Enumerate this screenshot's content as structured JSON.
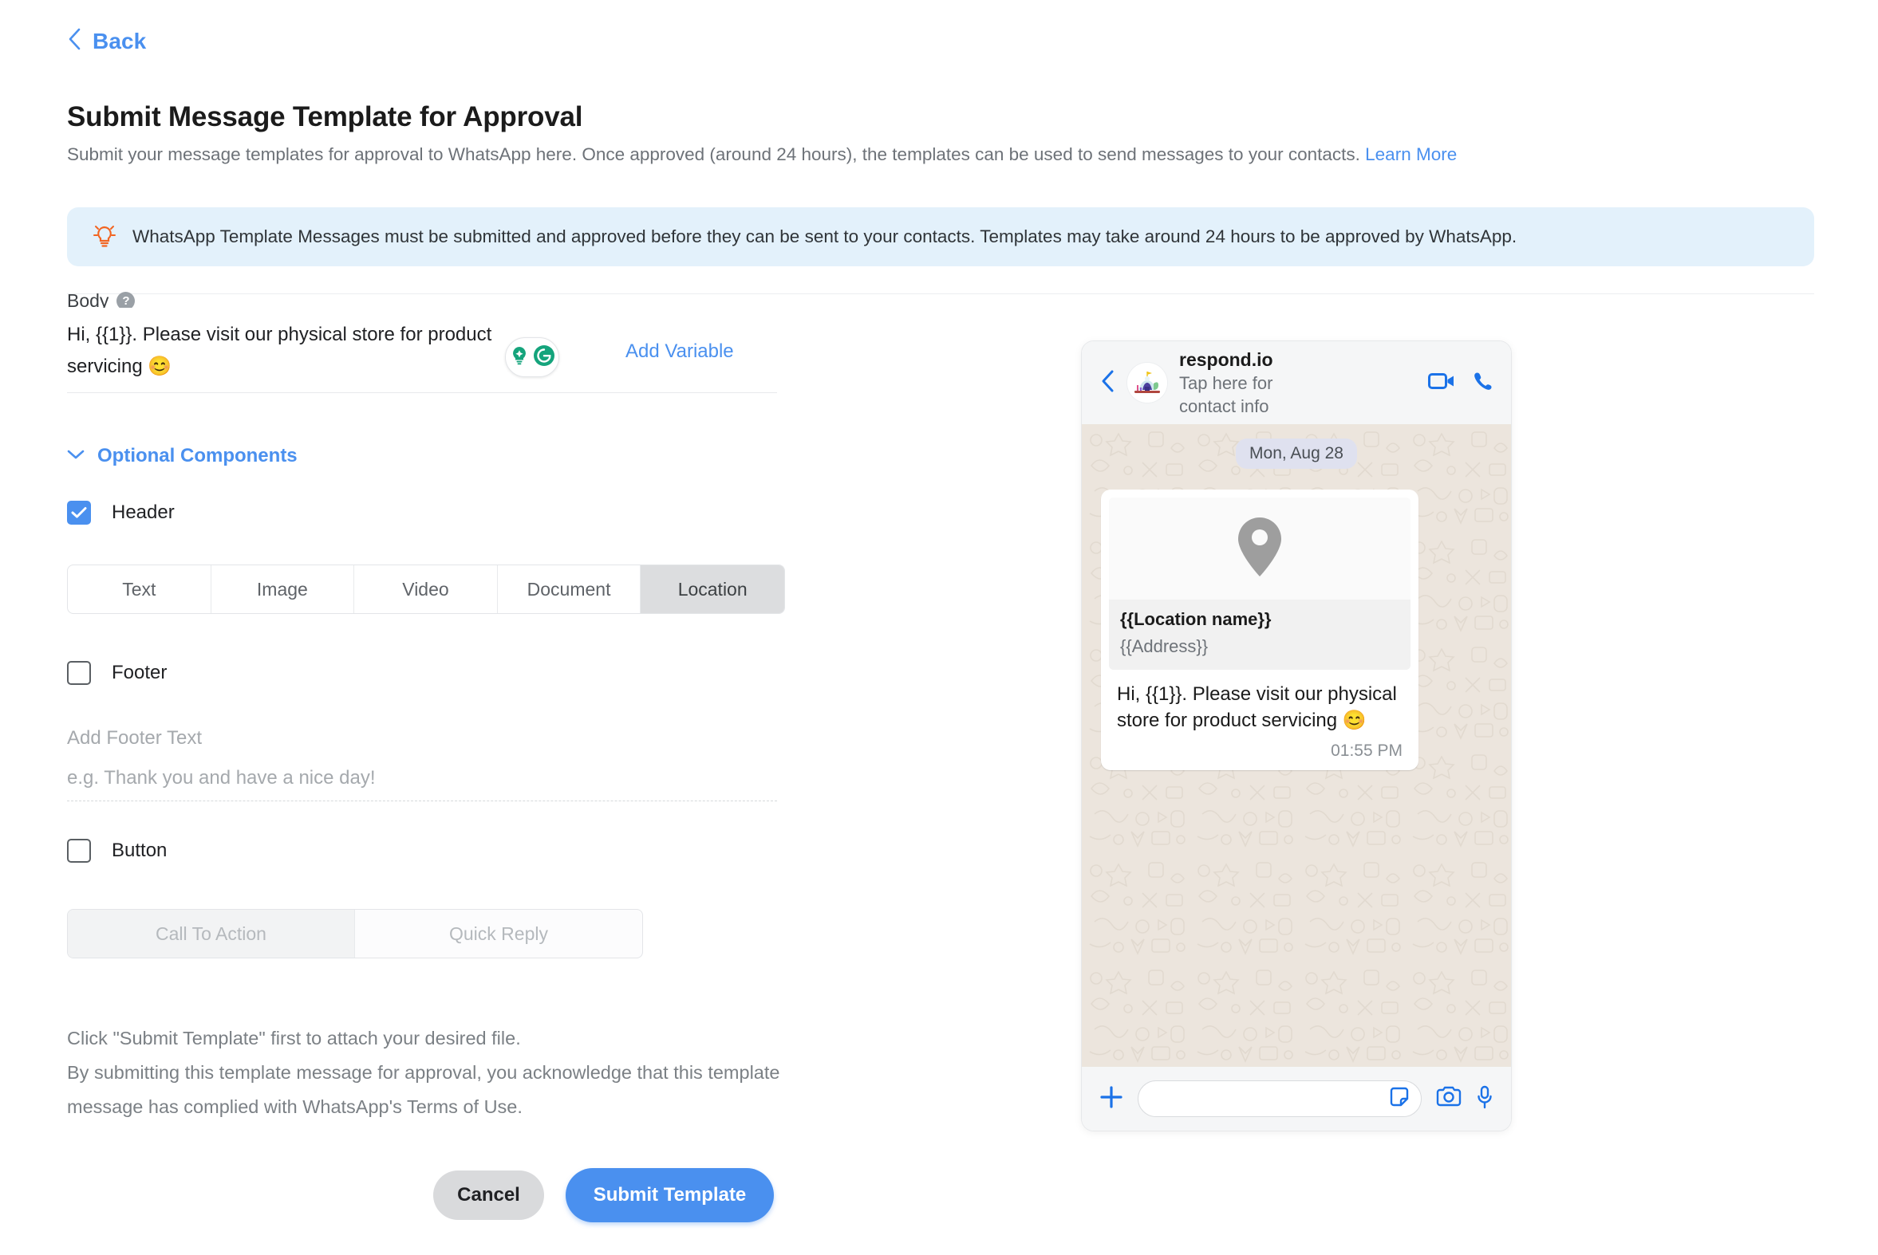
{
  "header": {
    "back_label": "Back",
    "title": "Submit Message Template for Approval",
    "description": "Submit your message templates for approval to WhatsApp here. Once approved (around 24 hours), the templates can be used to send messages to your contacts. ",
    "learn_more": "Learn More"
  },
  "banner": {
    "text": "WhatsApp Template Messages must be submitted and approved before they can be sent to your contacts. Templates may take around 24 hours to be approved by WhatsApp."
  },
  "body_section": {
    "label": "Body",
    "help_glyph": "?",
    "text": "Hi, {{1}}. Please visit our physical store for product servicing 😊",
    "add_variable_label": "Add Variable"
  },
  "optional": {
    "label": "Optional Components",
    "header": {
      "label": "Header",
      "checked": true,
      "tabs": [
        "Text",
        "Image",
        "Video",
        "Document",
        "Location"
      ],
      "active_tab": "Location"
    },
    "footer": {
      "label": "Footer",
      "checked": false,
      "field_label": "Add Footer Text",
      "placeholder": "e.g. Thank you and have a nice day!"
    },
    "button": {
      "label": "Button",
      "checked": false,
      "tabs": [
        "Call To Action",
        "Quick Reply"
      ],
      "active_tab": "Call To Action"
    }
  },
  "disclaimers": {
    "line1": "Click \"Submit Template\" first to attach your desired file.",
    "line2": "By submitting this template message for approval, you acknowledge that this template message has complied with WhatsApp's Terms of Use."
  },
  "actions": {
    "cancel_label": "Cancel",
    "submit_label": "Submit Template"
  },
  "preview": {
    "contact_name": "respond.io",
    "contact_sub": "Tap here for contact info",
    "date_pill": "Mon, Aug 28",
    "location_name": "{{Location name}}",
    "location_address": "{{Address}}",
    "message_text": "Hi, {{1}}. Please visit our physical store for product servicing 😊",
    "timestamp": "01:55 PM"
  },
  "colors": {
    "accent_blue": "#4a90ef",
    "banner_bg": "#e3f1fb",
    "banner_icon": "#f26522",
    "grammarly_green": "#15a47c",
    "whatsapp_bg": "#ece5dd",
    "tab_active_bg": "#dcdddf"
  }
}
